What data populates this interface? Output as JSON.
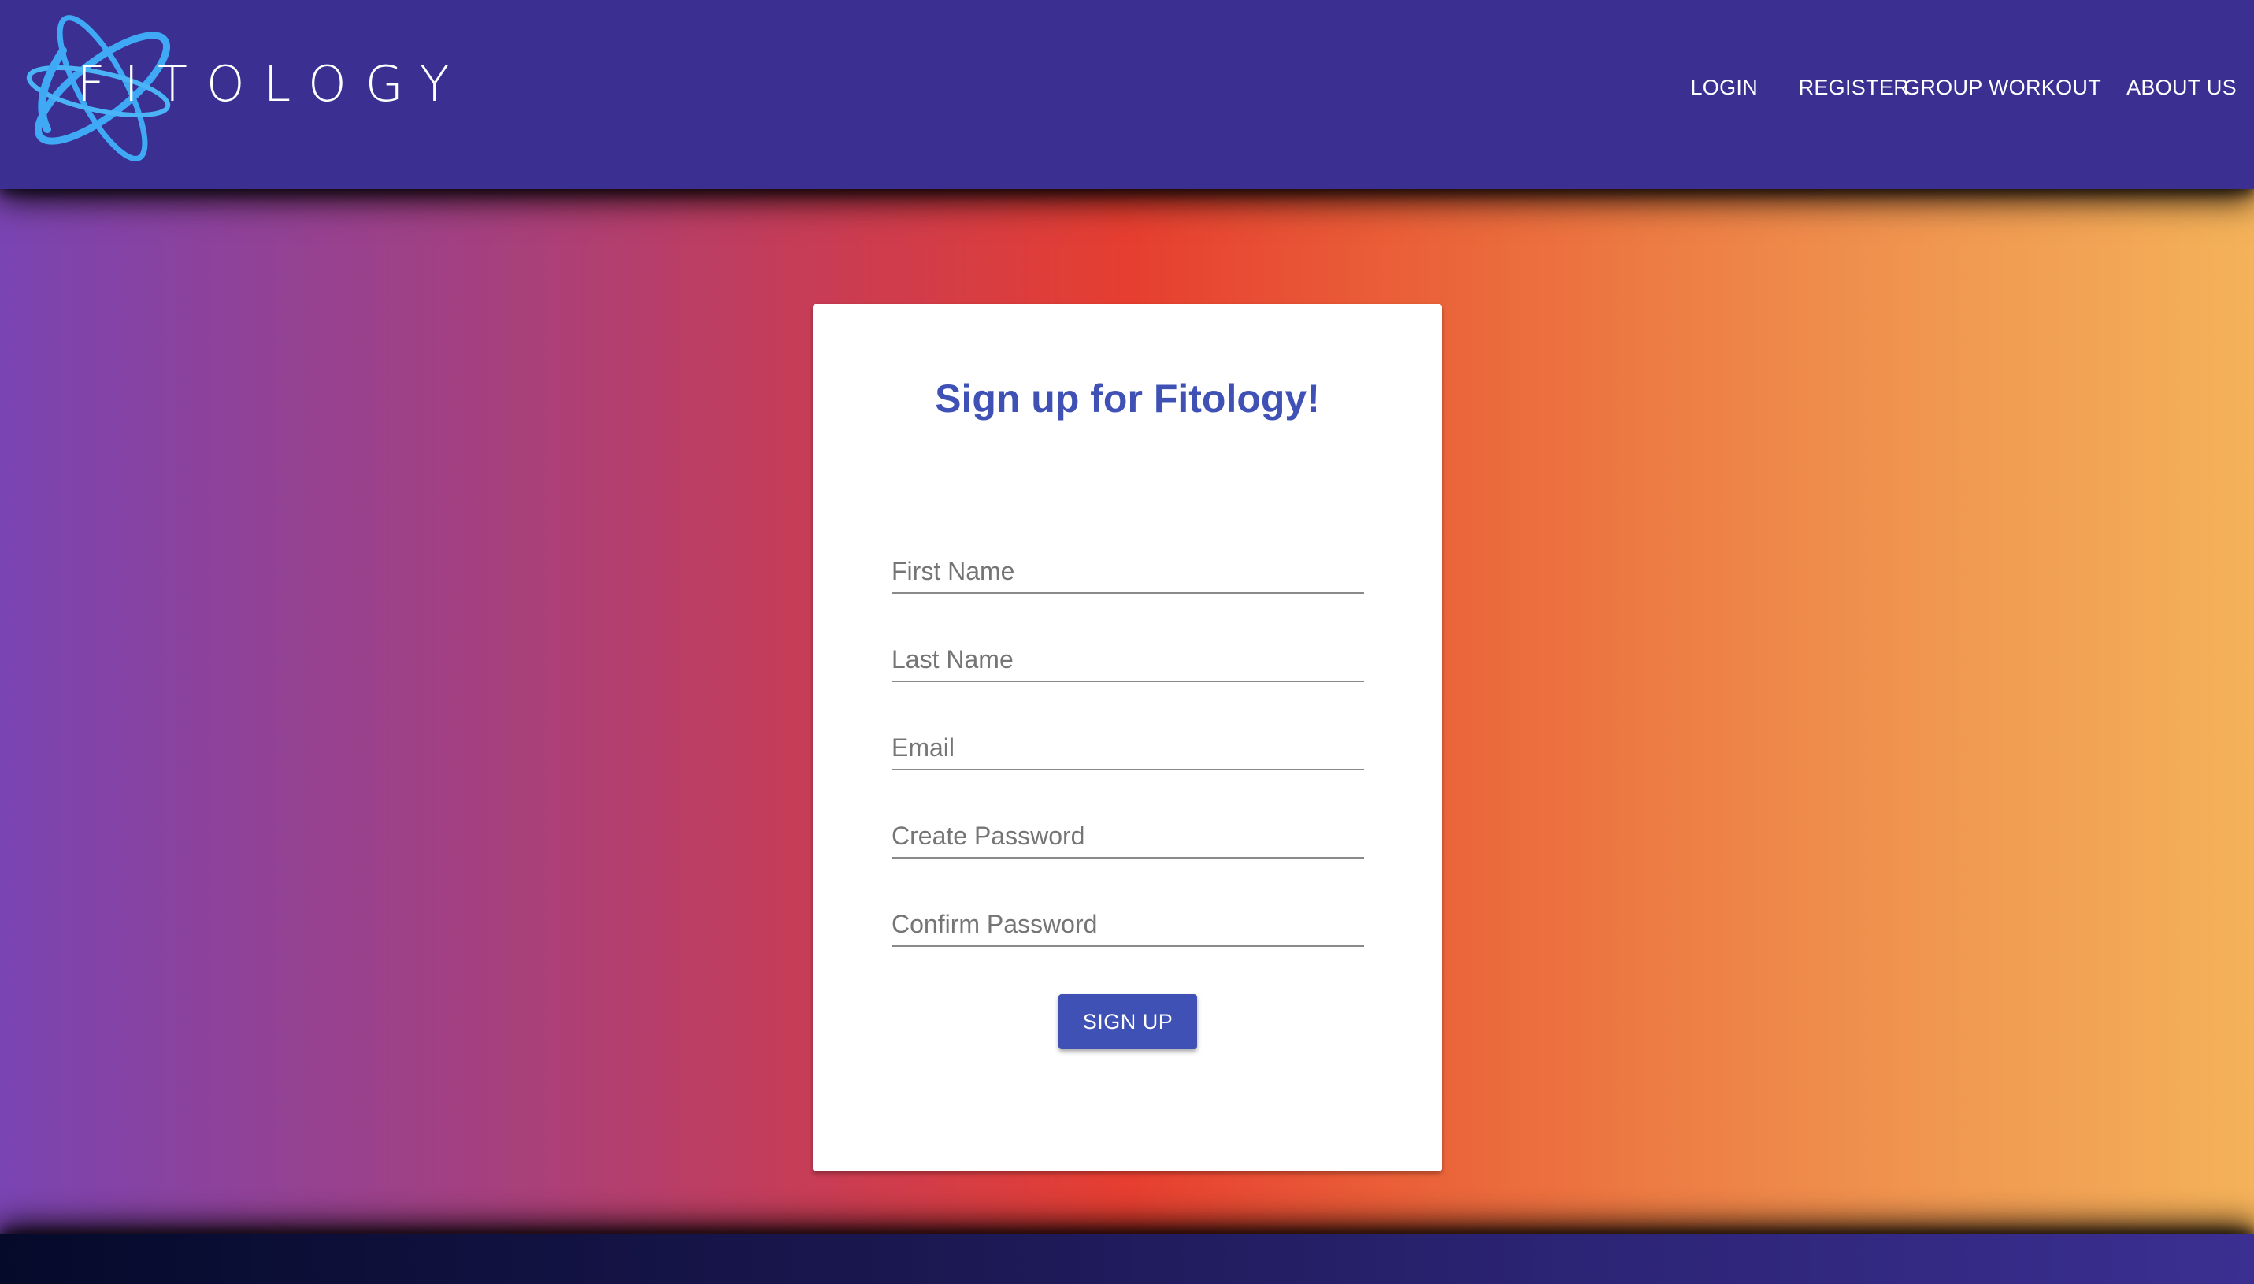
{
  "header": {
    "logo_text": "FITOLOGY",
    "nav": [
      {
        "label": "LOGIN"
      },
      {
        "label": "REGISTER"
      },
      {
        "label": "GROUP WORKOUT"
      },
      {
        "label": "ABOUT US"
      }
    ]
  },
  "form": {
    "title": "Sign up for Fitology!",
    "fields": [
      {
        "placeholder": "First Name"
      },
      {
        "placeholder": "Last Name"
      },
      {
        "placeholder": "Email"
      },
      {
        "placeholder": "Create Password"
      },
      {
        "placeholder": "Confirm Password"
      }
    ],
    "submit_label": "SIGN UP"
  },
  "colors": {
    "header_bg": "#3b2f91",
    "accent": "#3f51b5",
    "logo_orbit": "#3fa9f5"
  }
}
